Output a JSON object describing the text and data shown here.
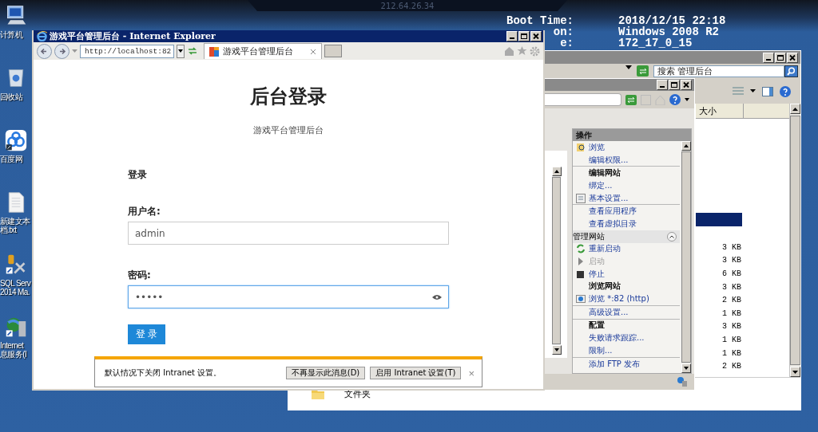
{
  "remote_bar": {
    "address": "212.64.26.34"
  },
  "desktop_icons": [
    {
      "lines": [
        "计算机"
      ]
    },
    {
      "lines": [
        "回收站"
      ]
    },
    {
      "lines": [
        "百度网"
      ]
    },
    {
      "lines": [
        "新建文本",
        "档.txt"
      ]
    },
    {
      "lines": [
        "SQL Serv",
        "2014 Ma."
      ]
    },
    {
      "lines": [
        "Internet",
        "息服务(I"
      ]
    }
  ],
  "system_info": [
    {
      "label": "Boot Time:",
      "value": "2018/12/15 22:18"
    },
    {
      "label": "on:",
      "value": "Windows 2008 R2"
    },
    {
      "label": "e:",
      "value": "172_17_0_15"
    }
  ],
  "explorer": {
    "search": {
      "placeholder": "搜索 管理后台"
    },
    "columns": [
      "大小"
    ],
    "rows": [
      {
        "selected": true
      },
      {
        "size": "3 KB",
        "selected": false
      },
      {
        "size": "3 KB",
        "selected": false
      },
      {
        "size": "6 KB",
        "selected": false
      },
      {
        "size": "3 KB",
        "selected": false
      },
      {
        "size": "2 KB",
        "selected": false
      },
      {
        "size": "1 KB",
        "selected": false
      },
      {
        "size": "3 KB",
        "selected": false
      },
      {
        "size": "1 KB",
        "selected": false
      },
      {
        "size": "1 KB",
        "selected": false
      },
      {
        "size": "2 KB",
        "selected": false
      }
    ],
    "details": {
      "type": "文件夹"
    }
  },
  "iis": {
    "actions_title": "操作",
    "actions": [
      {
        "kind": "link",
        "label": "浏览",
        "disabled": false,
        "separated": false
      },
      {
        "kind": "link",
        "label": "编辑权限...",
        "disabled": false,
        "separated": false
      },
      {
        "kind": "heading",
        "label": "编辑网站",
        "disabled": false,
        "separated": true
      },
      {
        "kind": "link",
        "label": "绑定...",
        "disabled": false,
        "separated": false
      },
      {
        "kind": "link",
        "label": "基本设置...",
        "disabled": false,
        "separated": false
      },
      {
        "kind": "link",
        "label": "查看应用程序",
        "disabled": false,
        "separated": true
      },
      {
        "kind": "link",
        "label": "查看虚拟目录",
        "disabled": false,
        "separated": false
      },
      {
        "kind": "section",
        "label": "管理网站",
        "disabled": false,
        "separated": false
      },
      {
        "kind": "link",
        "label": "重新启动",
        "disabled": false,
        "separated": false
      },
      {
        "kind": "link",
        "label": "启动",
        "disabled": true,
        "separated": false
      },
      {
        "kind": "link",
        "label": "停止",
        "disabled": false,
        "separated": false
      },
      {
        "kind": "heading",
        "label": "浏览网站",
        "disabled": false,
        "separated": false
      },
      {
        "kind": "link",
        "label": "浏览 *:82 (http)",
        "disabled": false,
        "separated": false
      },
      {
        "kind": "link",
        "label": "高级设置...",
        "disabled": false,
        "separated": true
      },
      {
        "kind": "heading",
        "label": "配置",
        "disabled": false,
        "separated": true
      },
      {
        "kind": "link",
        "label": "失败请求跟踪...",
        "disabled": false,
        "separated": false
      },
      {
        "kind": "link",
        "label": "限制...",
        "disabled": false,
        "separated": false
      },
      {
        "kind": "link",
        "label": "添加 FTP 发布",
        "disabled": false,
        "separated": true
      }
    ]
  },
  "browser": {
    "title": "游戏平台管理后台 - Internet Explorer",
    "address": "http://localhost:82",
    "tab": {
      "label": "游戏平台管理后台",
      "selected": true
    },
    "page": {
      "heading": "后台登录",
      "subtitle": "游戏平台管理后台",
      "form_title": "登录",
      "fields": [
        {
          "label": "用户名:",
          "value": "admin",
          "kind": "text",
          "focused": false
        },
        {
          "label": "密码:",
          "value": "•••••",
          "kind": "password",
          "focused": true
        }
      ],
      "submit": "登 录"
    },
    "info_bar": {
      "message": "默认情况下关闭 Intranet 设置。",
      "buttons": [
        "不再显示此消息(D)",
        "启用 Intranet 设置(T)"
      ],
      "close": "×"
    }
  }
}
